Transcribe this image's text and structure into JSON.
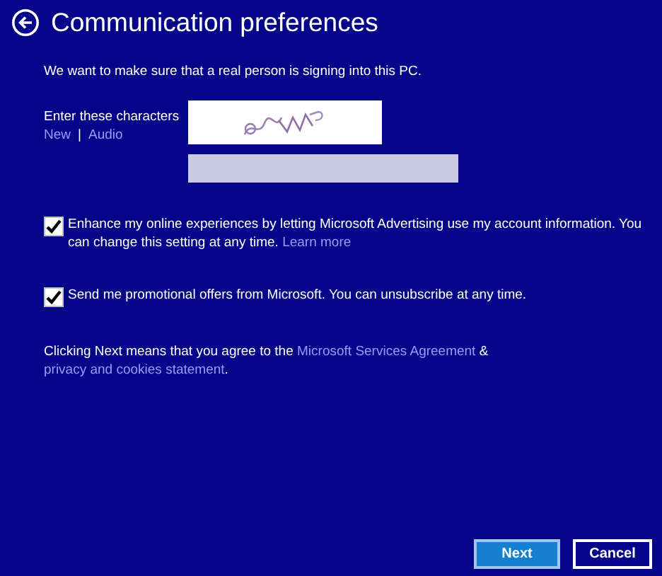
{
  "header": {
    "title": "Communication preferences"
  },
  "intro": "We want to make sure that a real person is signing into this PC.",
  "captcha": {
    "label": "Enter these characters",
    "links": [
      "New",
      "Audio"
    ],
    "separator": "|"
  },
  "options": [
    {
      "text": "Enhance my online experiences by letting Microsoft Advertising use my account information. You can change this setting at any time.",
      "link": "Learn more",
      "checked": true
    },
    {
      "text": "Send me promotional offers from Microsoft. You can unsubscribe at any time.",
      "checked": true
    }
  ],
  "agreement": [
    {
      "kind": "text",
      "text": "Clicking Next means that you agree to the "
    },
    {
      "kind": "link",
      "text": "Microsoft Services Agreement"
    },
    {
      "kind": "text",
      "text": " & "
    },
    {
      "kind": "link",
      "text": "privacy and cookies statement"
    },
    {
      "kind": "text",
      "text": "."
    }
  ],
  "buttons": [
    {
      "label": "Next",
      "kind": "primary"
    },
    {
      "label": "Cancel",
      "kind": "secondary"
    }
  ]
}
